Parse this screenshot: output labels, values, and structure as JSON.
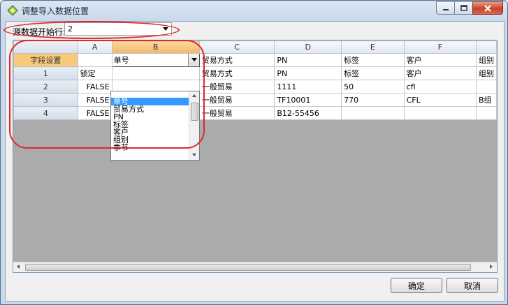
{
  "window": {
    "title": "调整导入数据位置"
  },
  "start_row": {
    "label": "源数据开始行:",
    "value": "2"
  },
  "grid": {
    "column_headers": [
      "",
      "A",
      "B",
      "C",
      "D",
      "E",
      "F",
      ""
    ],
    "field_row": {
      "header": "字段设置",
      "cells": [
        "",
        "单号",
        "贸易方式",
        "PN",
        "标签",
        "客户",
        "组别"
      ]
    },
    "rows": [
      {
        "header": "1",
        "cells": [
          "锁定",
          "",
          "贸易方式",
          "PN",
          "标签",
          "客户",
          "组别"
        ]
      },
      {
        "header": "2",
        "cells": [
          "FALSE",
          "",
          "一般贸易",
          "1111",
          "50",
          "cfl",
          ""
        ]
      },
      {
        "header": "3",
        "cells": [
          "FALSE",
          "",
          "一般贸易",
          "TF10001",
          "770",
          "CFL",
          "B组"
        ]
      },
      {
        "header": "4",
        "cells": [
          "FALSE",
          "",
          "一般贸易",
          "B12-55456",
          "",
          "",
          ""
        ]
      }
    ]
  },
  "dropdown": {
    "items": [
      "单号",
      "贸易方式",
      "PN",
      "标签",
      "客户",
      "组别",
      "季节"
    ],
    "selected": "单号"
  },
  "buttons": {
    "ok": "确定",
    "cancel": "取消"
  },
  "colors": {
    "annotation": "#e0282b",
    "selection": "#3399ff",
    "field_header": "#f7c978"
  }
}
